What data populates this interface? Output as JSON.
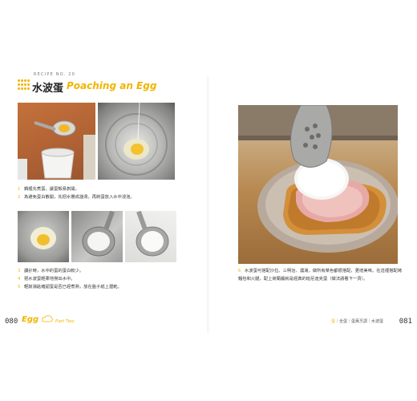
{
  "header": {
    "recipe_no": "RECIPE NO. 20",
    "title_zh": "水波蛋",
    "title_en": "Poaching an Egg"
  },
  "steps_top": [
    {
      "num": "1",
      "text": "鍋裡先煮蛋，讓蛋殼易剝開。"
    },
    {
      "num": "2",
      "text": "為避免蛋白散開，先把水攪成漩渦，再將蛋放入水中浸泡。"
    }
  ],
  "steps_middle": [
    {
      "num": "3",
      "text": "讀計時，水中的蛋的蛋白較少。"
    },
    {
      "num": "4",
      "text": "把水波蛋輕柔地撈出水中。"
    },
    {
      "num": "5",
      "text": "輕敲湯匙確認蛋是否已經煮熟，放在盤子紙上瀝乾。"
    }
  ],
  "steps_right": [
    {
      "num": "6",
      "text": "水波蛋可搭配沙拉、三明治、濃湯，做所有菜色都很搭配，更增美味。在這裡搭配烤麵包和火腿，配上荷蘭醬就是經典的班尼迪克蛋（做法請看下一頁）。"
    }
  ],
  "footer": {
    "page_left": "080",
    "brand": "Egg",
    "brand_part": "Part Two",
    "running_head_highlight": "蛋",
    "running_head_rest": "｜全蛋｜蛋黃烹調｜水波蛋",
    "page_right": "081"
  },
  "colors": {
    "accent": "#f2b400",
    "text": "#333333"
  }
}
